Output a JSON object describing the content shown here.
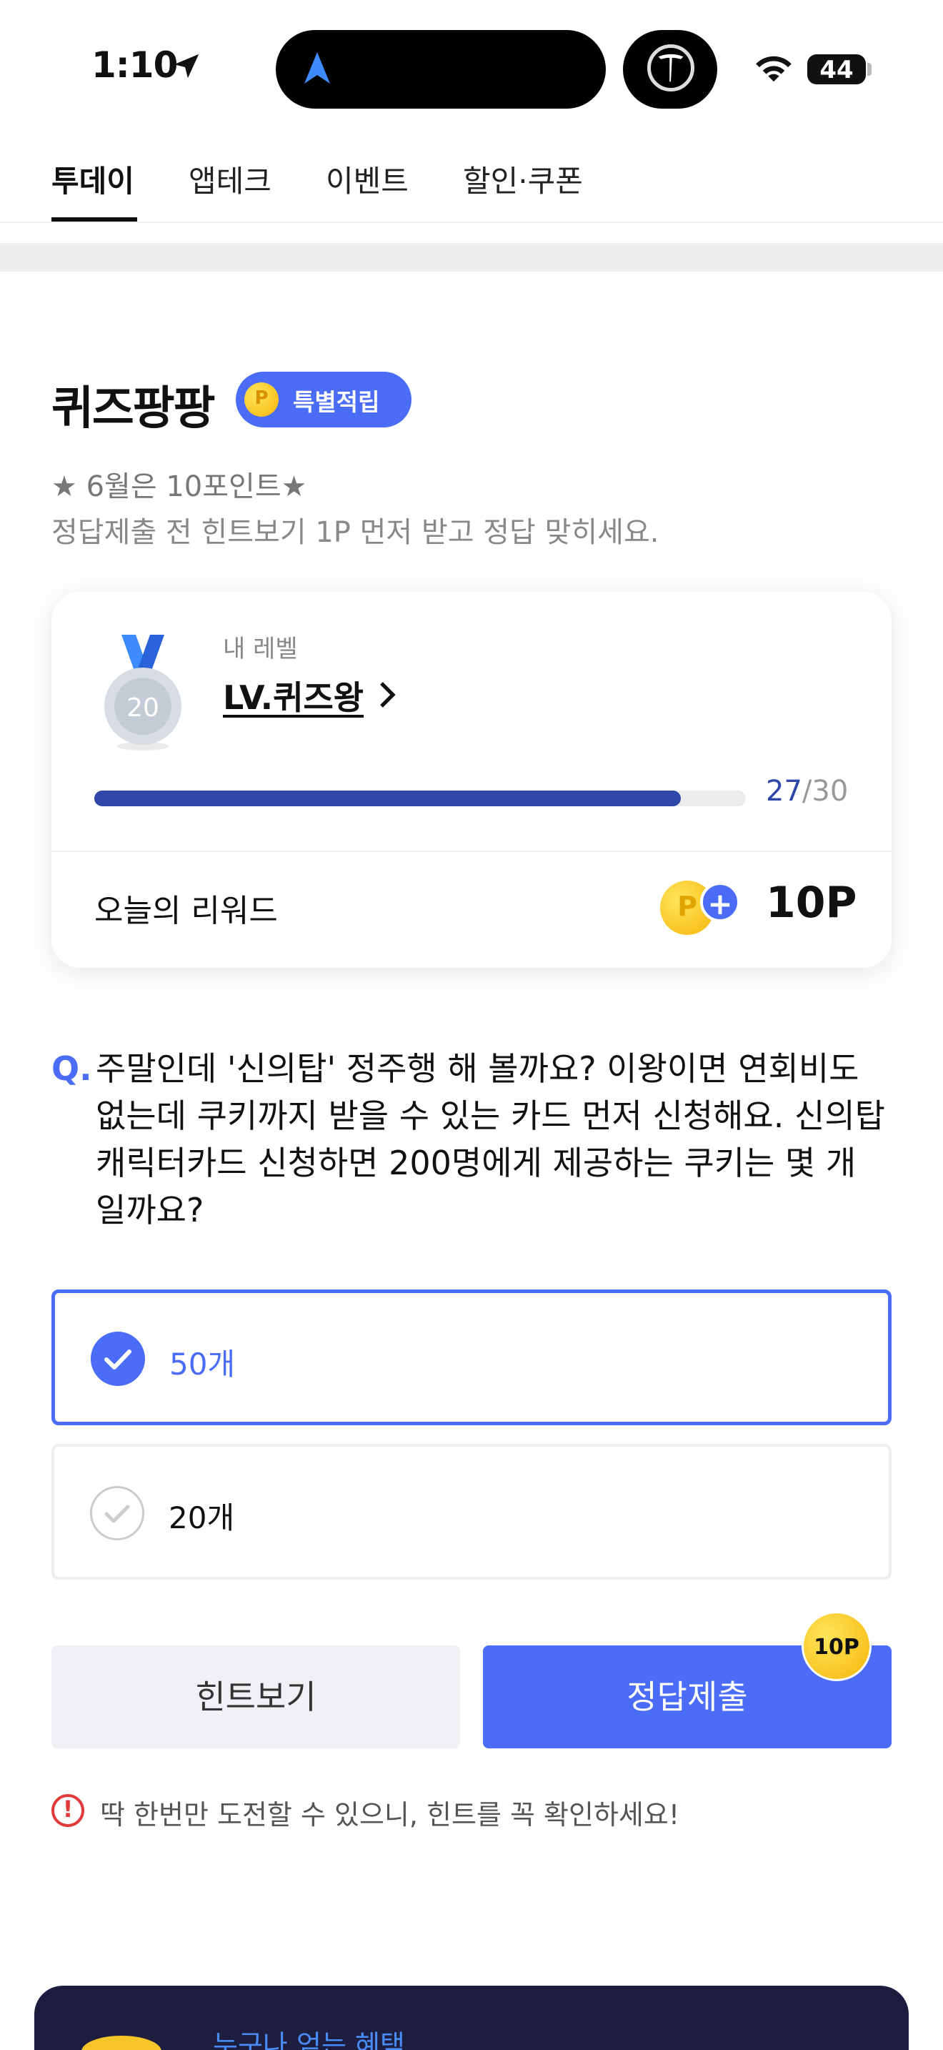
{
  "status_bar": {
    "time": "1:10",
    "battery": "44",
    "colors": {
      "nav_arrow": "#3d8bff"
    }
  },
  "tabs": [
    {
      "label": "투데이",
      "active": true
    },
    {
      "label": "앱테크",
      "active": false
    },
    {
      "label": "이벤트",
      "active": false
    },
    {
      "label": "할인·쿠폰",
      "active": false
    }
  ],
  "header": {
    "title": "퀴즈팡팡",
    "badge": {
      "coin_letter": "P",
      "label": "특별적립"
    },
    "subtitle_1": "★ 6월은 10포인트★",
    "subtitle_2": "정답제출 전 힌트보기 1P 먼저 받고 정답 맞히세요."
  },
  "level_card": {
    "medal_number": "20",
    "my_level_label": "내 레벨",
    "level_name": "LV.퀴즈왕",
    "progress": {
      "current": "27",
      "total": "30",
      "separator": "/",
      "fraction": 0.9
    },
    "reward_label": "오늘의 리워드",
    "reward_coin_letter": "P",
    "reward_plus": "+",
    "reward_value": "10P"
  },
  "question": {
    "mark": "Q.",
    "text": "주말인데 '신의탑' 정주행 해 볼까요? 이왕이면 연회비도 없는데 쿠키까지 받을 수 있는 카드 먼저 신청해요. 신의탑 캐릭터카드 신청하면 200명에게 제공하는 쿠키는 몇 개 일까요?"
  },
  "options": [
    {
      "label": "50개",
      "selected": true
    },
    {
      "label": "20개",
      "selected": false
    }
  ],
  "buttons": {
    "hint": "힌트보기",
    "submit": "정답제출",
    "submit_badge": "10P"
  },
  "warning": {
    "icon": "!",
    "text": "딱 한번만 도전할 수 있으니, 힌트를 꼭 확인하세요!"
  },
  "banner": {
    "text": "누구나 얻는 혜택"
  },
  "colors": {
    "accent": "#4a6cf7",
    "progress": "#2e47a8",
    "warning": "#e03a3a",
    "banner_bg": "#1c1d3f",
    "coin": "#f5b50a"
  }
}
